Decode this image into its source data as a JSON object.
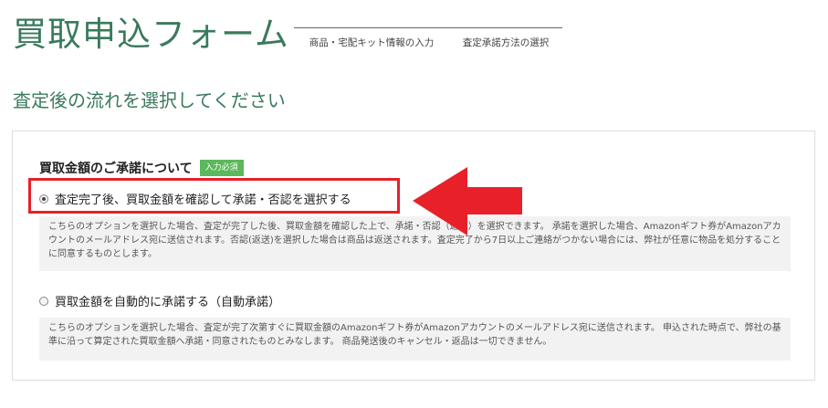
{
  "header": {
    "title": "買取申込フォーム",
    "steps": [
      {
        "label": "商品・宅配キット情報の入力"
      },
      {
        "label": "査定承諾方法の選択"
      }
    ]
  },
  "subtitle": "査定後の流れを選択してください",
  "section": {
    "title": "買取金額のご承諾について",
    "badge": "入力必須"
  },
  "options": [
    {
      "label": "査定完了後、買取金額を確認して承諾・否認を選択する",
      "checked": true,
      "description": "こちらのオプションを選択した場合、査定が完了した後、買取金額を確認した上で、承諾・否認（返送）を選択できます。 承諾を選択した場合、Amazonギフト券がAmazonアカウントのメールアドレス宛に送信されます。否認(返送)を選択した場合は商品は返送されます。査定完了から7日以上ご連絡がつかない場合には、弊社が任意に物品を処分することに同意するものとします。"
    },
    {
      "label": "買取金額を自動的に承諾する（自動承諾）",
      "checked": false,
      "description": "こちらのオプションを選択した場合、査定が完了次第すぐに買取金額のAmazonギフト券がAmazonアカウントのメールアドレス宛に送信されます。 申込された時点で、弊社の基準に沿って算定された買取金額へ承諾・同意されたものとみなします。 商品発送後のキャンセル・返品は一切できません。"
    }
  ],
  "colors": {
    "brand_green": "#3a7a5c",
    "badge_green": "#5cb85c",
    "highlight_red": "#e8202a"
  }
}
